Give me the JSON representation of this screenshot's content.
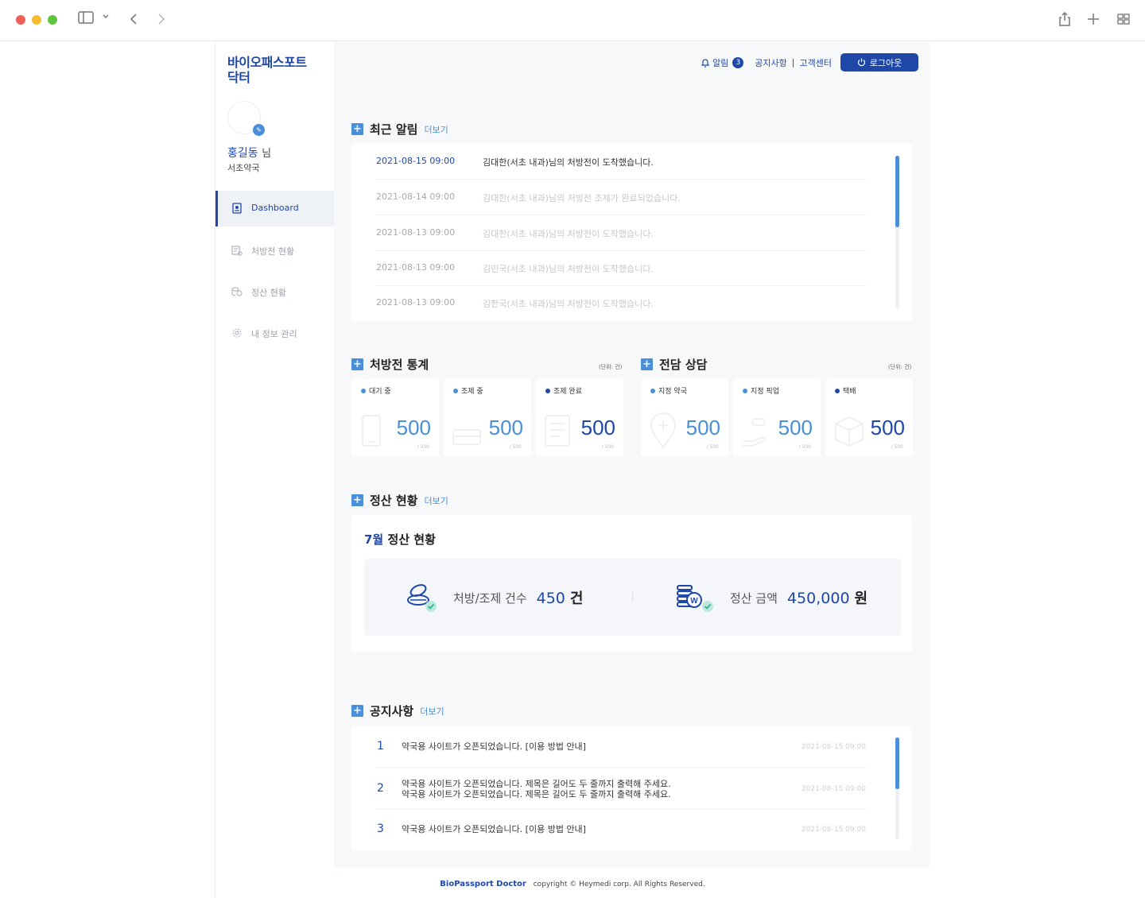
{
  "browser": {
    "controls": [
      "close",
      "minimize",
      "maximize"
    ],
    "icons": [
      "sidebar-icon",
      "chevron-down-icon",
      "back-icon",
      "forward-icon",
      "share-icon",
      "new-tab-icon",
      "tab-overview-icon"
    ]
  },
  "sidebar": {
    "brand_line1": "바이오패스포트",
    "brand_line2": "닥터",
    "user_name": "홍길동",
    "user_suffix": "님",
    "user_pharmacy": "서초약국",
    "items": [
      {
        "label": "Dashboard",
        "icon": "dashboard-icon",
        "active": true
      },
      {
        "label": "처방전 현황",
        "icon": "prescription-icon",
        "active": false
      },
      {
        "label": "정산 현황",
        "icon": "settlement-icon",
        "active": false
      },
      {
        "label": "내 정보 관리",
        "icon": "gear-icon",
        "active": false
      }
    ]
  },
  "topbar": {
    "alarm_label": "알림",
    "alarm_count": "3",
    "notice_link": "공지사항",
    "separator": "|",
    "support_link": "고객센터",
    "logout_label": "로그아웃"
  },
  "alerts": {
    "title": "최근 알림",
    "more": "더보기",
    "rows": [
      {
        "datetime": "2021-08-15 09:00",
        "message": "김대한(서초 내과)님의 처방전이 도착했습니다."
      },
      {
        "datetime": "2021-08-14 09:00",
        "message": "김대한(서초 내과)님의 처방전 조제가 완료되었습니다."
      },
      {
        "datetime": "2021-08-13 09:00",
        "message": "김대한(서초 내과)님의 처방전이 도착했습니다."
      },
      {
        "datetime": "2021-08-13 09:00",
        "message": "김민국(서초 내과)님의 처방전이 도착했습니다."
      },
      {
        "datetime": "2021-08-13 09:00",
        "message": "김한국(서초 내과)님의 처방전이 도착했습니다."
      }
    ]
  },
  "prescription_stats": {
    "title": "처방전 통계",
    "unit": "(단위: 건)",
    "items": [
      {
        "label": "대기 중",
        "value": "500",
        "total": "/ 500",
        "icon": "phone-icon"
      },
      {
        "label": "조제 중",
        "value": "500",
        "total": "/ 500",
        "icon": "medicine-box-icon"
      },
      {
        "label": "조제 완료",
        "value": "500",
        "total": "/ 500",
        "icon": "document-icon"
      }
    ]
  },
  "consultation": {
    "title": "전담 상담",
    "unit": "(단위: 건)",
    "items": [
      {
        "label": "지정 약국",
        "value": "500",
        "total": "/ 500",
        "icon": "location-pin-icon"
      },
      {
        "label": "지정 픽업",
        "value": "500",
        "total": "/ 500",
        "icon": "hand-pill-icon"
      },
      {
        "label": "택배",
        "value": "500",
        "total": "/ 500",
        "icon": "parcel-box-icon"
      }
    ]
  },
  "settlement": {
    "title": "정산 현황",
    "more": "더보기",
    "month": "7월",
    "subtitle": "정산 현황",
    "count_label": "처방/조제 건수",
    "count_value": "450",
    "count_unit": "건",
    "amount_label": "정산 금액",
    "amount_value": "450,000",
    "amount_unit": "원"
  },
  "notices": {
    "title": "공지사항",
    "more": "더보기",
    "rows": [
      {
        "no": "1",
        "line1": "약국용 사이트가 오픈되었습니다. [이용 방법 안내]",
        "line2": "",
        "date": "2021-08-15 09:00"
      },
      {
        "no": "2",
        "line1": "약국용 사이트가 오픈되었습니다. 제목은 길어도 두 줄까지 출력해 주세요.",
        "line2": "약국용 사이트가 오픈되었습니다. 제목은 길어도 두 줄까지 출력해 주세요.",
        "date": "2021-08-15 09:00"
      },
      {
        "no": "3",
        "line1": "약국용 사이트가 오픈되었습니다. [이용 방법 안내]",
        "line2": "",
        "date": "2021-08-15 09:00"
      }
    ]
  },
  "footer": {
    "brand": "BioPassport Doctor",
    "copyright": "copyright © Heymedi corp. All Rights Reserved."
  },
  "colors": {
    "primary": "#1f47a8",
    "accent": "#4a8fd8",
    "background": "#f7f8fa"
  }
}
